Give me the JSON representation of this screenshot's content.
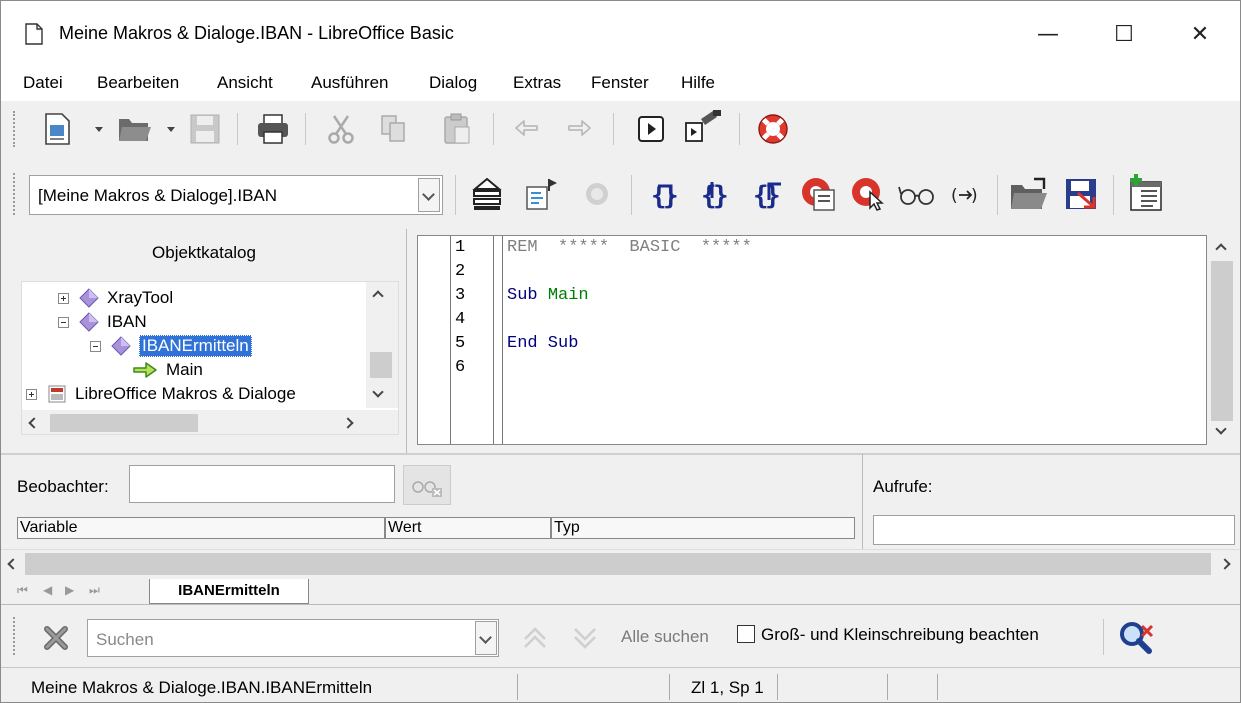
{
  "window": {
    "title": "Meine Makros & Dialoge.IBAN - LibreOffice Basic",
    "minimize_glyph": "—",
    "maximize_glyph": "☐",
    "close_glyph": "✕"
  },
  "menu": [
    "Datei",
    "Bearbeiten",
    "Ansicht",
    "Ausführen",
    "Dialog",
    "Extras",
    "Fenster",
    "Hilfe"
  ],
  "library_selector": {
    "value": "[Meine Makros & Dialoge].IBAN"
  },
  "object_catalog": {
    "title": "Objektkatalog",
    "items": [
      {
        "label": "XrayTool",
        "icon": "module-diamond-icon",
        "expander": "closed"
      },
      {
        "label": "IBAN",
        "icon": "module-diamond-icon",
        "expander": "open"
      },
      {
        "label": "IBANErmitteln",
        "icon": "module-diamond-icon",
        "expander": "open",
        "selected": true
      },
      {
        "label": "Main",
        "icon": "method-arrow-icon"
      },
      {
        "label": "LibreOffice Makros & Dialoge",
        "icon": "library-container-icon",
        "expander": "closed"
      }
    ]
  },
  "editor": {
    "line_numbers": [
      "1",
      "2",
      "3",
      "4",
      "5",
      "6"
    ],
    "lines": [
      {
        "parts": [
          {
            "text": "REM  *****  BASIC  *****",
            "kind": "rem"
          }
        ]
      },
      {
        "parts": []
      },
      {
        "parts": [
          {
            "text": "Sub",
            "kind": "kw"
          },
          {
            "text": " ",
            "kind": "plain"
          },
          {
            "text": "Main",
            "kind": "id"
          }
        ]
      },
      {
        "parts": []
      },
      {
        "parts": [
          {
            "text": "End Sub",
            "kind": "kw"
          }
        ]
      },
      {
        "parts": []
      }
    ]
  },
  "watch": {
    "label": "Beobachter:",
    "input_value": "",
    "columns": [
      "Variable",
      "Wert",
      "Typ"
    ]
  },
  "calls": {
    "label": "Aufrufe:"
  },
  "tabs": {
    "active": "IBANErmitteln"
  },
  "find": {
    "placeholder": "Suchen",
    "find_all": "Alle suchen",
    "match_case": "Groß- und Kleinschreibung beachten",
    "match_case_checked": false
  },
  "status": {
    "location": "Meine Makros & Dialoge.IBAN.IBANErmitteln",
    "position": "Zl 1, Sp 1"
  },
  "colors": {
    "selection": "#3072d6",
    "keyword": "#000080",
    "identifier": "#008000",
    "comment": "#808080"
  }
}
